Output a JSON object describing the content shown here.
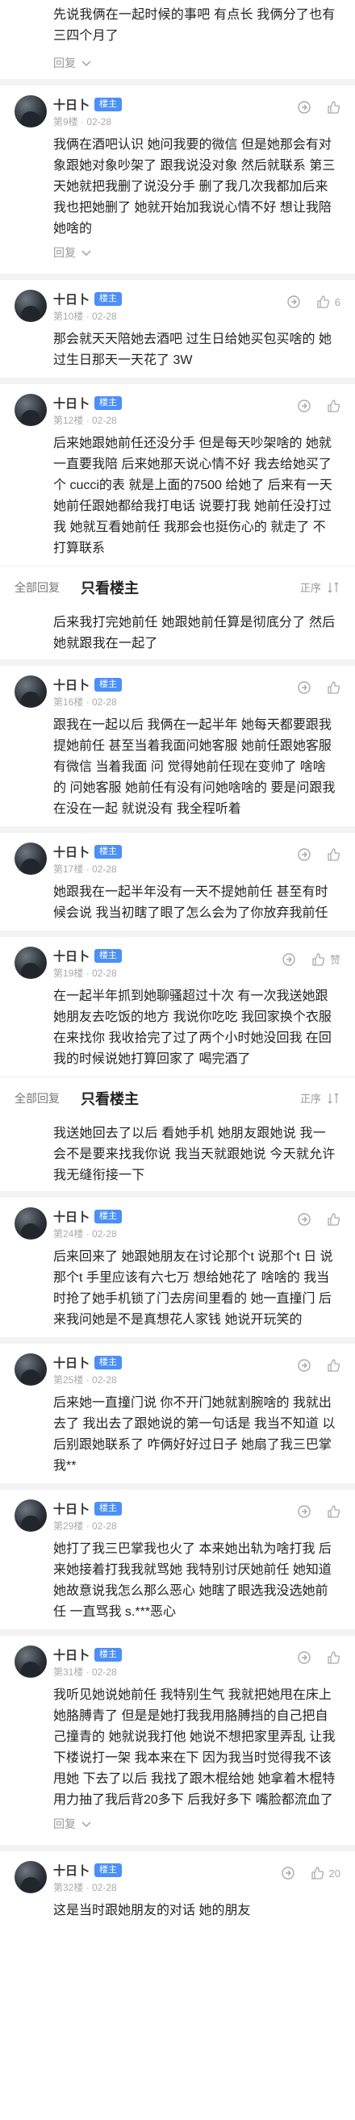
{
  "top_post": {
    "text": "先说我俩在一起时候的事吧 有点长 我俩分了也有三四个月了",
    "expand_label": "回复"
  },
  "user_name": "十日卜",
  "badge": "楼主",
  "expand_label": "回复",
  "floors": [
    {
      "floor": "第9楼",
      "date": "02-28",
      "likes": "",
      "text": "我俩在酒吧认识 她问我要的微信 但是她那会有对象跟她对象吵架了 跟我说没对象 然后就联系 第三天她就把我删了说没分手 删了我几次我都加后来我也把她删了 她就开始加我说心情不好 想让我陪她啥的",
      "show_expand": true
    },
    {
      "floor": "第10楼",
      "date": "02-28",
      "likes": "6",
      "text": "那会就天天陪她去酒吧 过生日给她买包买啥的 她过生日那天一天花了 3W",
      "show_expand": false
    },
    {
      "floor": "第12楼",
      "date": "02-28",
      "likes": "",
      "text": "后来她跟她前任还没分手 但是每天吵架啥的 她就一直要我陪 后来她那天说心情不好 我去给她买了个 cucci的表 就是上面的7500 给她了 后来有一天她前任跟她都给我打电话 说要打我 她前任没打过我 她就互看她前任 我那会也挺伤心的 就走了 不打算联系",
      "show_expand": false
    }
  ],
  "filter": {
    "all": "全部回复",
    "only": "只看楼主",
    "sort": "正序"
  },
  "after_filter_text": "后来我打完她前任 她跟她前任算是彻底分了 然后她就跟我在一起了",
  "floors2": [
    {
      "floor": "第16楼",
      "date": "02-28",
      "likes": "",
      "text": "跟我在一起以后 我俩在一起半年 她每天都要跟我提她前任 甚至当着我面问她客服 她前任跟她客服有微信 当着我面 问 觉得她前任现在变帅了 啥啥的 问她客服 她前任有没有问她啥啥的 要是问跟我在没在一起 就说没有 我全程听着"
    },
    {
      "floor": "第17楼",
      "date": "02-28",
      "likes": "",
      "text": "她跟我在一起半年没有一天不提她前任 甚至有时候会说 我当初瞎了眼了怎么会为了你放弃我前任"
    },
    {
      "floor": "第19楼",
      "date": "02-28",
      "likes": "赞",
      "text": "在一起半年抓到她聊骚超过十次 有一次我送她跟她朋友去吃饭的地方 我说你吃吃 我回家换个衣服在来找你 我收拾完了过了两个小时她没回我 在回我的时候说她打算回家了 喝完酒了"
    }
  ],
  "filter2": {
    "all": "全部回复",
    "only": "只看楼主",
    "sort": "正序"
  },
  "after_filter2_text": "我送她回去了以后 看她手机 她朋友跟她说 我一会不是要来找我你说 我当天就跟她说 今天就允许我无缝衔接一下",
  "floors3": [
    {
      "floor": "第24楼",
      "date": "02-28",
      "likes": "",
      "text": "后来回来了 她跟她朋友在讨论那个t 说那个t 日 说那个t 手里应该有六七万 想给她花了 啥啥的 我当时抢了她手机锁了门去房间里看的 她一直撞门 后来我问她是不是真想花人家钱 她说开玩笑的"
    },
    {
      "floor": "第25楼",
      "date": "02-28",
      "likes": "",
      "text": "后来她一直撞门说 你不开门她就割腕啥的 我就出去了 我出去了跟她说的第一句话是 我当不知道 以后别跟她联系了 咋俩好好过日子 她扇了我三巴掌我**"
    },
    {
      "floor": "第29楼",
      "date": "02-28",
      "likes": "",
      "text": "她打了我三巴掌我也火了 本来她出轨为啥打我 后来她接着打我我就骂她 我特别讨厌她前任 她知道 她故意说我怎么那么恶心 她瞎了眼选我没选她前任 一直骂我 s.***恶心"
    },
    {
      "floor": "第31楼",
      "date": "02-28",
      "likes": "",
      "text": "我听见她说她前任 我特别生气 我就把她甩在床上 她胳膊青了 但是是她打我我用胳膊挡的自己把自己撞青的 她就说我打他 她说不想把家里弄乱 让我下楼说打一架 我本来在下 因为我当时觉得我不该甩她 下去了以后 我找了跟木棍给她 她拿着木棍特用力抽了我后背20多下 后我好多下 嘴脸都流血了"
    },
    {
      "floor": "第32楼",
      "date": "02-28",
      "likes": "20",
      "text": "这是当时跟她朋友的对话 她的朋友"
    }
  ]
}
